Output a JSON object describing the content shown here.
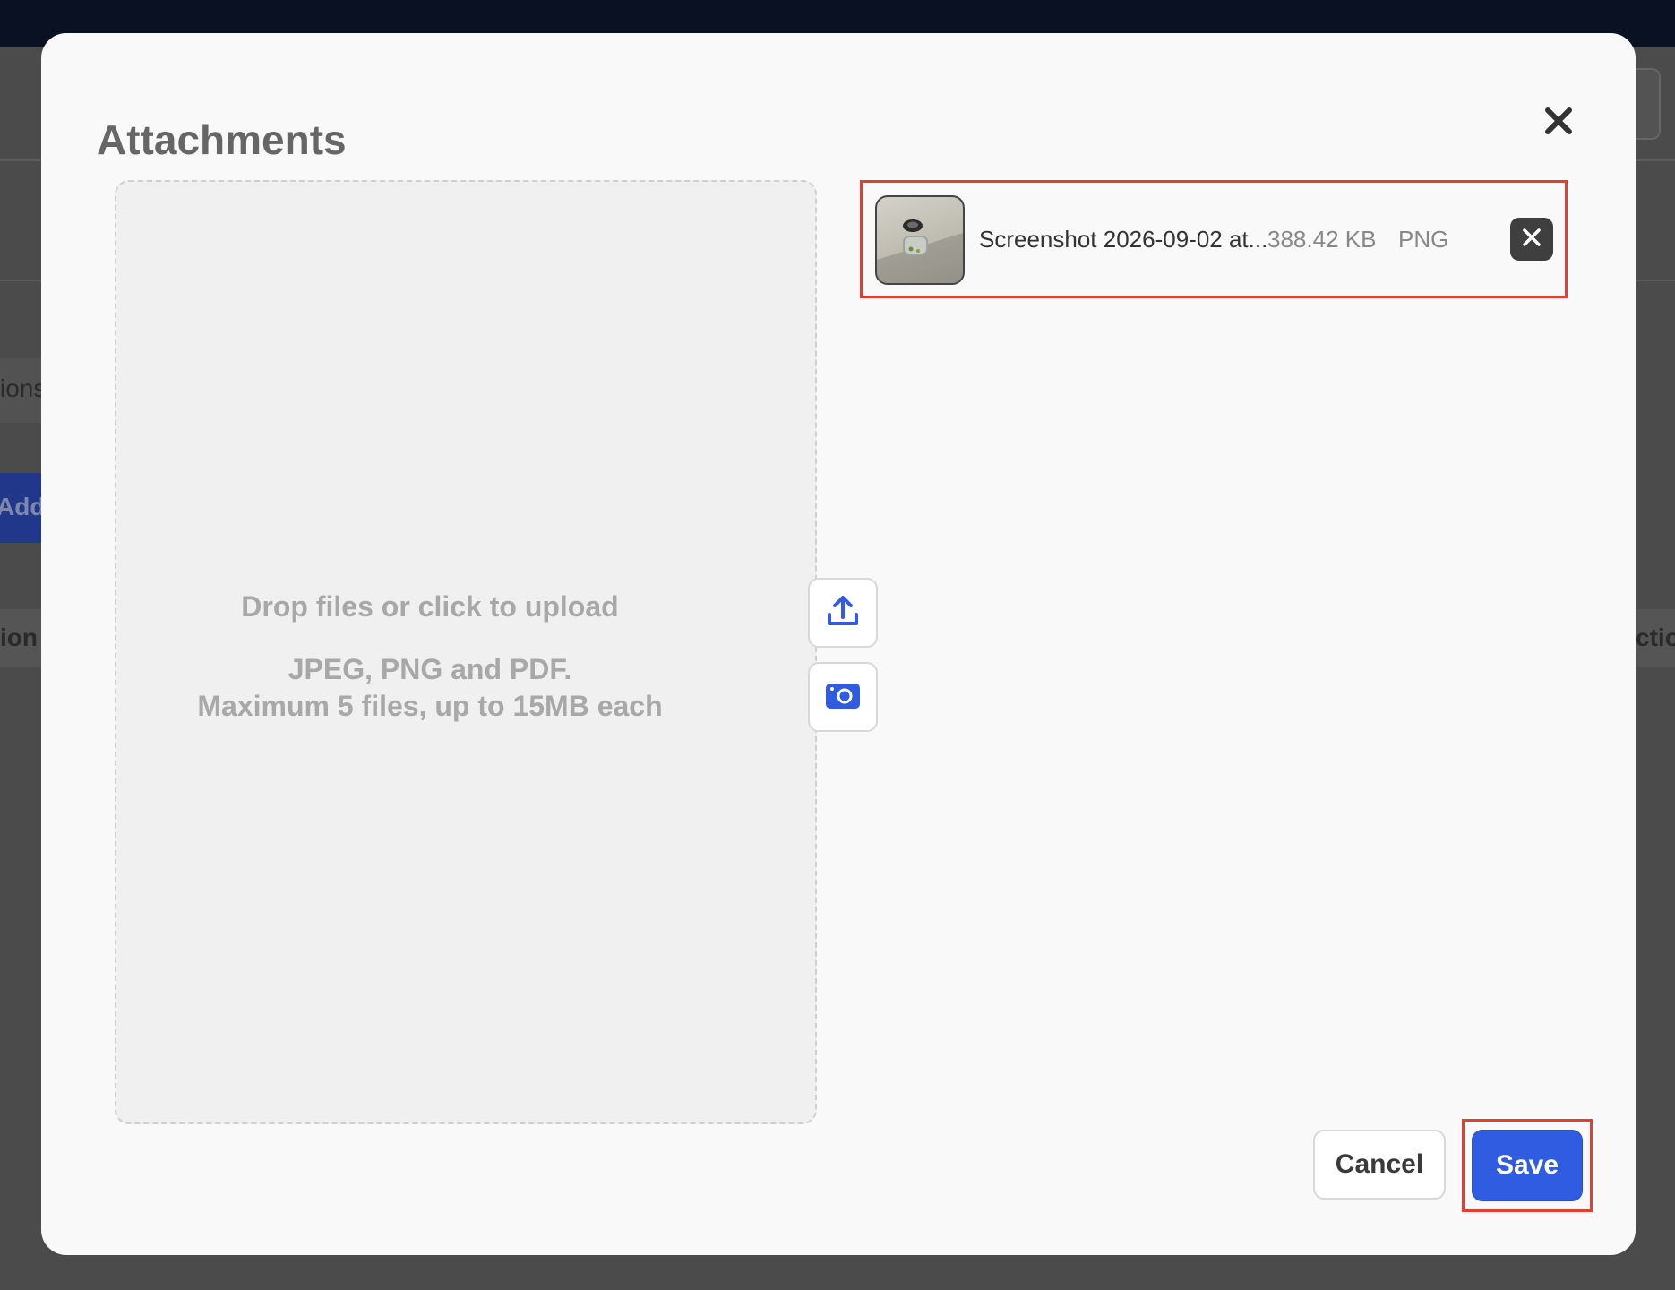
{
  "modal": {
    "title": "Attachments"
  },
  "dropzone": {
    "main_text": "Drop files or click to upload",
    "formats_text": "JPEG, PNG and PDF.",
    "limits_text": "Maximum 5 files, up to 15MB each"
  },
  "attachments": [
    {
      "name": "Screenshot 2026-09-02 at...",
      "size": "388.42 KB",
      "type": "PNG"
    }
  ],
  "footer": {
    "cancel_label": "Cancel",
    "save_label": "Save"
  },
  "background": {
    "partial_text_1": "ions",
    "partial_button": "Add",
    "partial_header_left": "ion /",
    "partial_header_right": "ctio"
  },
  "icons": {
    "close": "close-icon",
    "upload": "upload-icon",
    "camera": "camera-icon",
    "remove": "remove-file-icon"
  },
  "colors": {
    "primary": "#2f5ce0",
    "highlight": "#e0402c",
    "topbar": "#0a1122",
    "icon_blue": "#2f5ce0"
  }
}
